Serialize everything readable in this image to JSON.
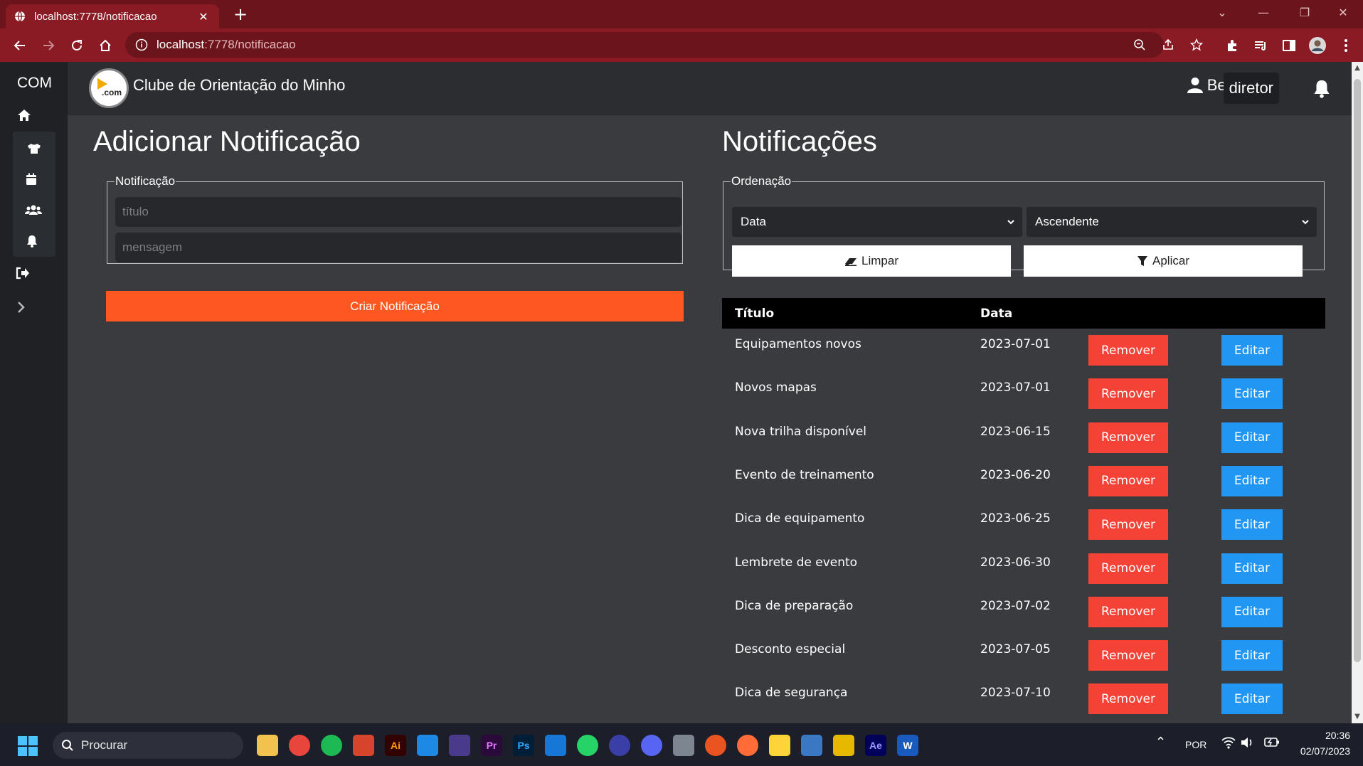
{
  "browser": {
    "tab_title": "localhost:7778/notificacao",
    "tab_close": "✕",
    "new_tab": "+",
    "url_host": "localhost",
    "url_rest": ":7778/notificacao"
  },
  "sidebar": {
    "brand": "COM",
    "items": [
      "home-icon",
      "shirt-icon",
      "calendar-icon",
      "users-icon",
      "bell-icon",
      "logout-icon",
      "expand-icon"
    ]
  },
  "header": {
    "site_title": "Clube de Orientação do Minho",
    "logo_text": ".com",
    "user_name": "Bekele",
    "user_role": "diretor"
  },
  "add_form": {
    "heading": "Adicionar Notificação",
    "legend": "Notificação",
    "title_placeholder": "título",
    "message_placeholder": "mensagem",
    "submit_label": "Criar Notificação"
  },
  "list": {
    "heading": "Notificações",
    "sort_legend": "Ordenação",
    "sort_field": "Data",
    "sort_order": "Ascendente",
    "clear_label": "Limpar",
    "apply_label": "Aplicar",
    "columns": [
      "Título",
      "Data"
    ],
    "remove_label": "Remover",
    "edit_label": "Editar",
    "rows": [
      {
        "title": "Equipamentos novos",
        "date": "2023-07-01"
      },
      {
        "title": "Novos mapas",
        "date": "2023-07-01"
      },
      {
        "title": "Nova trilha disponível",
        "date": "2023-06-15"
      },
      {
        "title": "Evento de treinamento",
        "date": "2023-06-20"
      },
      {
        "title": "Dica de equipamento",
        "date": "2023-06-25"
      },
      {
        "title": "Lembrete de evento",
        "date": "2023-06-30"
      },
      {
        "title": "Dica de preparação",
        "date": "2023-07-02"
      },
      {
        "title": "Desconto especial",
        "date": "2023-07-05"
      },
      {
        "title": "Dica de segurança",
        "date": "2023-07-10"
      }
    ]
  },
  "taskbar": {
    "search_label": "Procurar",
    "apps": [
      "explorer",
      "chrome",
      "spotify",
      "app-red",
      "Ai",
      "vscode",
      "app-purple",
      "Pr",
      "Ps",
      "mail",
      "whatsapp",
      "app-blue",
      "discord",
      "app-gray",
      "ubuntu",
      "postman",
      "lightbulb",
      "virtualbox",
      "app-yellow",
      "Ae",
      "W"
    ],
    "language": "POR",
    "time": "20:36",
    "date": "02/07/2023"
  },
  "colors": {
    "browser_frame": "#8a1a23",
    "app_bg": "#393b3f",
    "accent_orange": "#ff5722",
    "remove_red": "#f44336",
    "edit_blue": "#2196f3"
  }
}
